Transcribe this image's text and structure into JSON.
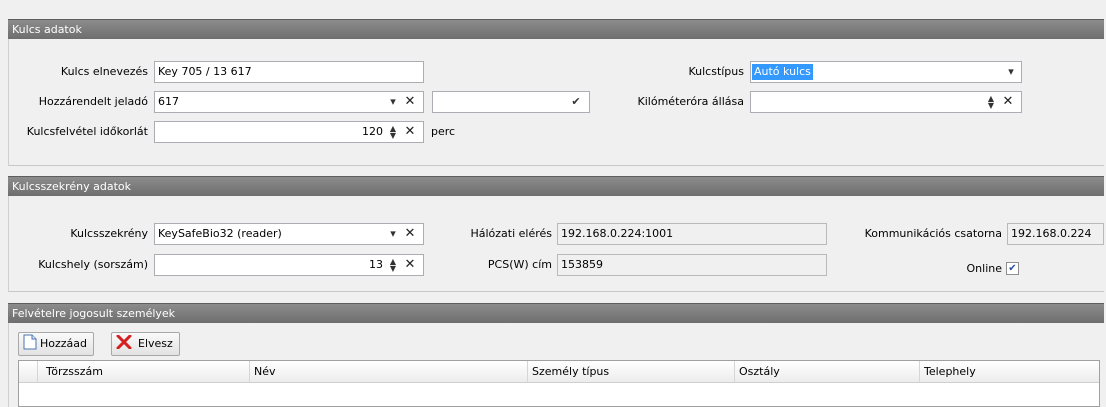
{
  "kulcs_section": {
    "title": "Kulcs adatok",
    "name_label": "Kulcs elnevezés",
    "name_value": "Key 705 / 13 617",
    "assigned_label": "Hozzárendelt jeladó",
    "assigned_value": "617",
    "timeout_label": "Kulcsfelvétel időkorlát",
    "timeout_value": "120",
    "timeout_unit": "perc",
    "type_label": "Kulcstípus",
    "type_value": "Autó kulcs",
    "odometer_label": "Kilóméteróra állása",
    "odometer_value": ""
  },
  "szekreny_section": {
    "title": "Kulcsszekrény adatok",
    "cabinet_label": "Kulcsszekrény",
    "cabinet_value": "KeySafeBio32 (reader)",
    "slot_label": "Kulcshely (sorszám)",
    "slot_value": "13",
    "network_label": "Hálózati elérés",
    "network_value": "192.168.0.224:1001",
    "pcs_label": "PCS(W) cím",
    "pcs_value": "153859",
    "comm_label": "Kommunikációs csatorna",
    "comm_value": "192.168.0.224",
    "online_label": "Online",
    "online_checked": true
  },
  "persons_section": {
    "title": "Felvételre jogosult személyek",
    "add_label": "Hozzáad",
    "remove_label": "Elvesz",
    "columns": [
      "Törzsszám",
      "Név",
      "Személy típus",
      "Osztály",
      "Telephely"
    ]
  },
  "icons": {
    "dropdown": "▾",
    "clear": "✕",
    "check": "✔",
    "spin": "⌃⌄",
    "checkbox_mark": "✔"
  },
  "colors": {
    "header_bg": "#7a7a7a",
    "selection": "#3399ff"
  }
}
